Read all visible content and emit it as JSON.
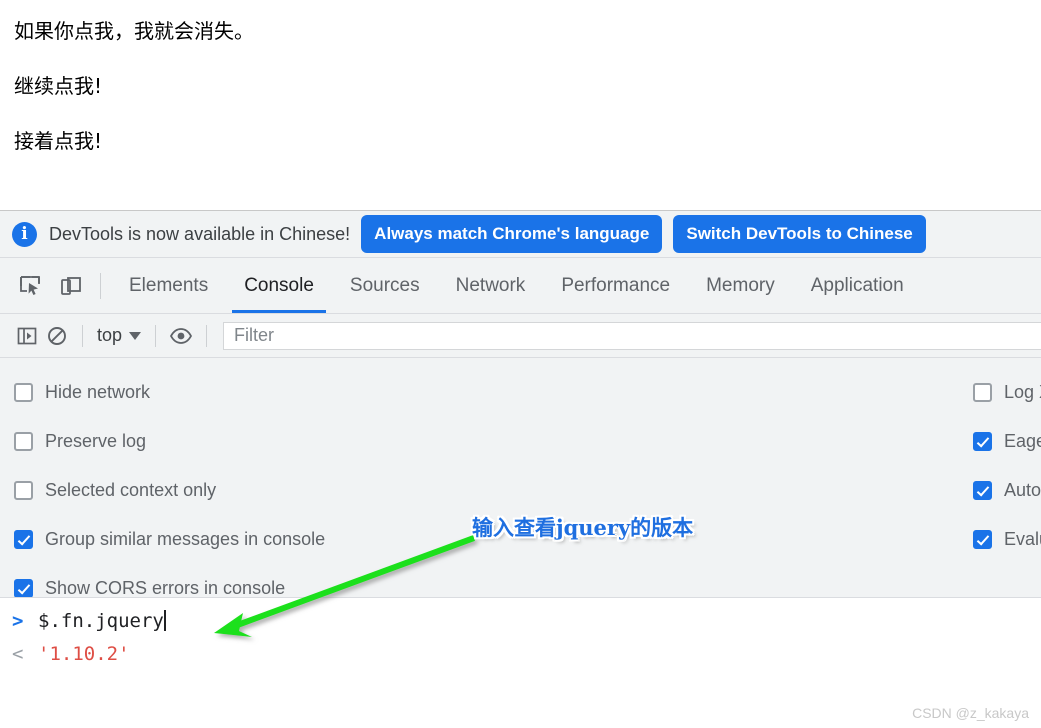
{
  "webpage": {
    "paragraphs": [
      "如果你点我，我就会消失。",
      "继续点我!",
      "接着点我!"
    ]
  },
  "devtools": {
    "notification": {
      "info_icon": "info-circle-icon",
      "message": "DevTools is now available in Chinese!",
      "buttons": [
        "Always match Chrome's language",
        "Switch DevTools to Chinese"
      ],
      "accent_color": "#1a73e8"
    },
    "tabbar": {
      "icons": [
        "inspect-element-icon",
        "device-toolbar-icon"
      ],
      "tabs": [
        {
          "label": "Elements",
          "active": false
        },
        {
          "label": "Console",
          "active": true
        },
        {
          "label": "Sources",
          "active": false
        },
        {
          "label": "Network",
          "active": false
        },
        {
          "label": "Performance",
          "active": false
        },
        {
          "label": "Memory",
          "active": false
        },
        {
          "label": "Application",
          "active": false
        }
      ],
      "active_tab": "Console",
      "active_indicator_color": "#1a73e8"
    },
    "console_toolbar": {
      "sidebar_toggle_icon": "console-sidebar-icon",
      "clear_console_icon": "clear-console-icon",
      "context_selector": "top",
      "context_caret_icon": "chevron-down-icon",
      "live_expression_icon": "eye-icon",
      "filter_placeholder": "Filter",
      "filter_value": ""
    },
    "settings": {
      "left_column": [
        {
          "label": "Hide network",
          "checked": false
        },
        {
          "label": "Preserve log",
          "checked": false
        },
        {
          "label": "Selected context only",
          "checked": false
        },
        {
          "label": "Group similar messages in console",
          "checked": true
        },
        {
          "label": "Show CORS errors in console",
          "checked": true
        }
      ],
      "right_column": [
        {
          "label": "Log XMLHttpRequests",
          "checked": false
        },
        {
          "label": "Eager evaluation",
          "checked": true
        },
        {
          "label": "Autocomplete from history",
          "checked": true
        },
        {
          "label": "Evaluate triggers user activation",
          "checked": true
        }
      ],
      "checkbox_checked_color": "#1a73e8"
    },
    "console_output": {
      "input_prompt": ">",
      "input_expression": "$.fn.jquery",
      "output_prompt": "<",
      "output_value": "'1.10.2'",
      "output_color": "#d93025"
    }
  },
  "annotation": {
    "text": "输入查看jquery的版本",
    "color": "#1f6fe0",
    "arrow_color": "#1fe01f"
  },
  "watermark": {
    "text": "CSDN @z_kakaya"
  }
}
